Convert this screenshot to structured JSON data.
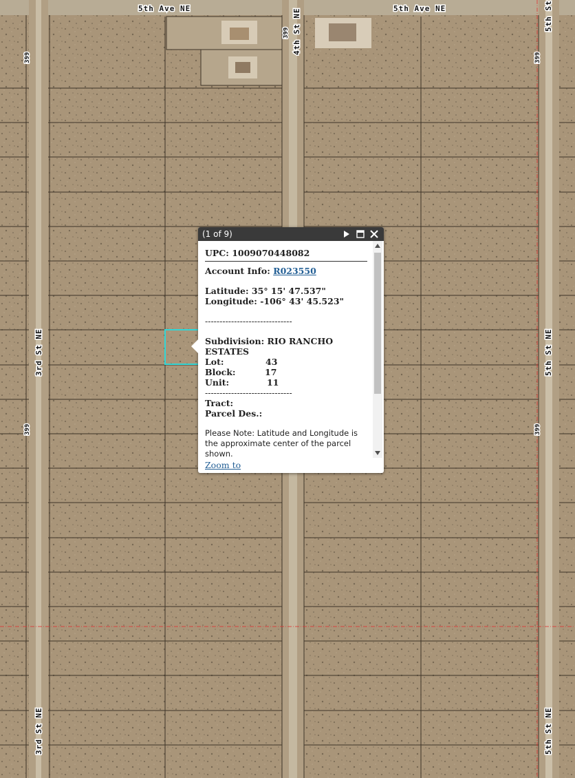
{
  "map": {
    "road_labels": {
      "fifth_ave_ne": "5th Ave NE",
      "fourth_st_ne": "4th St NE",
      "third_st_ne": "3rd St NE",
      "fifth_st_ne": "5th St NE",
      "fifth_st_short": "5th St"
    },
    "shield_value": "399",
    "colors": {
      "terrain": "#a89479",
      "parcel_lines": "#3d3428",
      "road": "#c8bca4",
      "selected_parcel": "#32d6d6",
      "boundary_red": "#e03030"
    }
  },
  "popup": {
    "counter": "(1 of 9)",
    "upc": "UPC: 1009070448082",
    "account_label": "Account Info:",
    "account_link": "R023550",
    "latitude": "Latitude: 35° 15' 47.537\"",
    "longitude": "Longitude: -106° 43' 45.523\"",
    "divider": "------------------------------",
    "subdivision_label": "Subdivision: RIO RANCHO",
    "subdivision_cont": "ESTATES",
    "lot_label": "Lot:",
    "lot_value": "43",
    "block_label": "Block:",
    "block_value": "17",
    "unit_label": "Unit:",
    "unit_value": "11",
    "tract_label": "Tract:",
    "parcel_des_label": "Parcel Des.:",
    "note_line1": "Please Note: Latitude and Longitude is",
    "note_line2": "the approximate center of the parcel",
    "note_line3": "shown.",
    "zoom_to": "Zoom to",
    "icons": {
      "next": "play-triangle-icon",
      "maximize": "maximize-icon",
      "close": "close-x-icon",
      "scroll_up": "arrow-up-icon",
      "scroll_down": "arrow-down-icon"
    }
  }
}
